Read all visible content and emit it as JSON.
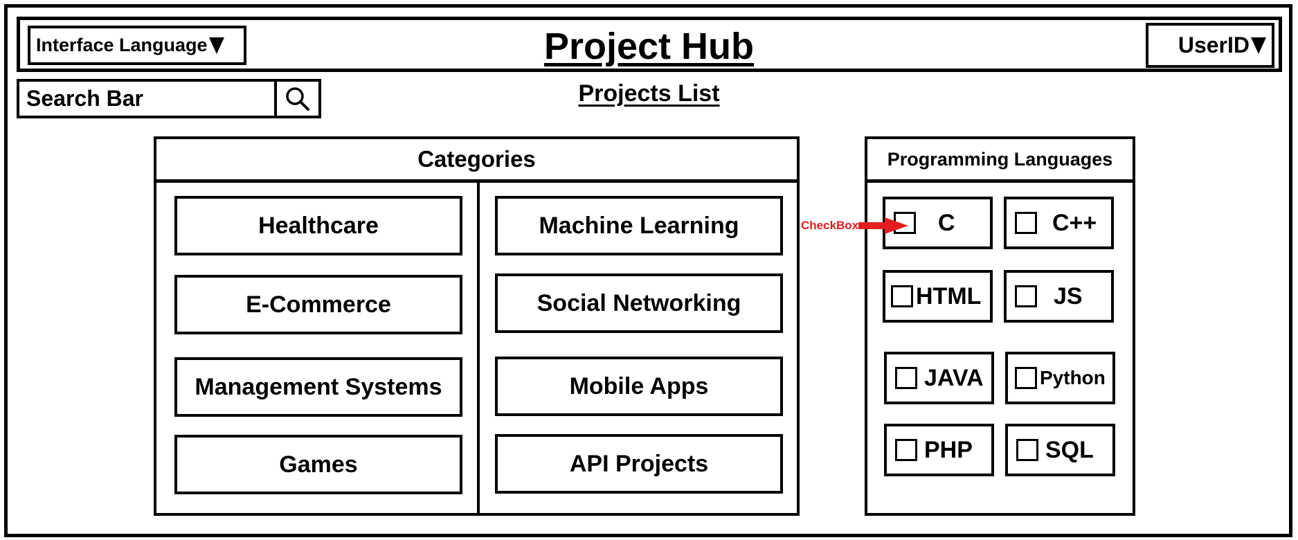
{
  "header": {
    "language_dropdown": "Interface Language",
    "title": "Project Hub",
    "user_dropdown": "UserID"
  },
  "search": {
    "placeholder": "Search Bar",
    "icon": "magnifier-icon"
  },
  "section_title": "Projects List",
  "categories": {
    "heading": "Categories",
    "left": [
      "Healthcare",
      "E-Commerce",
      "Management Systems",
      "Games"
    ],
    "right": [
      "Machine Learning",
      "Social Networking",
      "Mobile Apps",
      "API Projects"
    ]
  },
  "languages": {
    "heading": "Programming Languages",
    "items": [
      "C",
      "C++",
      "HTML",
      "JS",
      "JAVA",
      "Python",
      "PHP",
      "SQL"
    ]
  },
  "annotation": {
    "label": "CheckBox",
    "color": "#e41e1e"
  },
  "colors": {
    "line": "#000000",
    "background": "#ffffff",
    "annotation": "#e41e1e"
  }
}
